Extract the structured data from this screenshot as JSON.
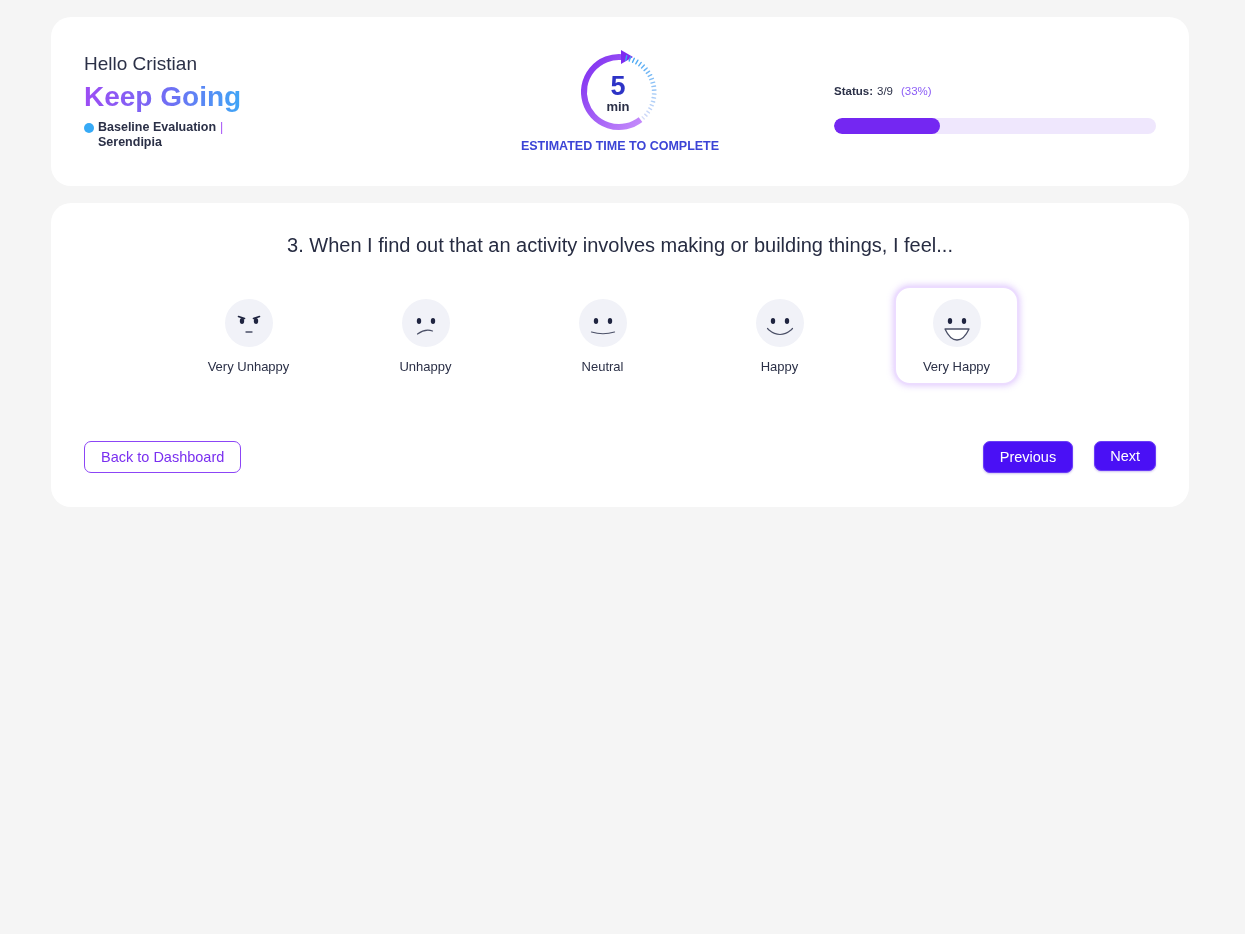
{
  "header": {
    "greeting": "Hello Cristian",
    "motto": "Keep Going",
    "evaluation": {
      "name": "Baseline Evaluation",
      "separator": "|",
      "organization": "Serendipia"
    }
  },
  "timer": {
    "value": "5",
    "unit": "min",
    "caption": "ESTIMATED TIME TO COMPLETE"
  },
  "status": {
    "label": "Status:",
    "count": "3/9",
    "percent": "(33%)",
    "level": 0.33
  },
  "question": {
    "text": "3. When I find out that an activity involves making or building things, I feel...",
    "options": [
      {
        "label": "Very Unhappy",
        "kind": "very-unhappy",
        "selected": false
      },
      {
        "label": "Unhappy",
        "kind": "unhappy",
        "selected": false
      },
      {
        "label": "Neutral",
        "kind": "neutral",
        "selected": false
      },
      {
        "label": "Happy",
        "kind": "happy",
        "selected": false
      },
      {
        "label": "Very Happy",
        "kind": "very-happy",
        "selected": true
      }
    ]
  },
  "buttons": [
    {
      "label": "Back to Dashboard",
      "kind": "outline"
    },
    {
      "label": "Previous",
      "kind": "filled"
    },
    {
      "label": "Next",
      "kind": "filled"
    }
  ]
}
